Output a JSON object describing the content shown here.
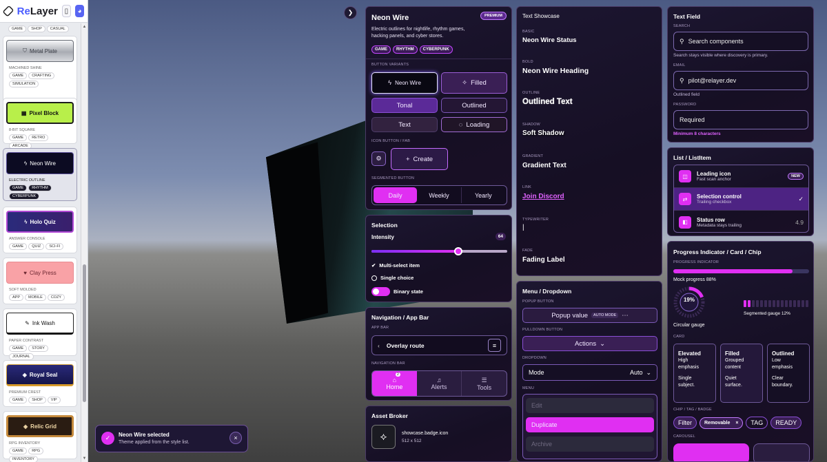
{
  "app": {
    "name_prefix": "Re",
    "name_suffix": "Layer"
  },
  "sidebar": {
    "top_tags": [
      "GAME",
      "SHOP",
      "CASUAL"
    ],
    "styles": [
      {
        "label": "Metal Plate",
        "sub": "MACHINED SHINE",
        "tags": [
          "GAME",
          "CRAFTING",
          "SIMULATION"
        ],
        "icon": "shield-icon"
      },
      {
        "label": "Pixel Block",
        "sub": "8-BIT SQUARE",
        "tags": [
          "GAME",
          "RETRO",
          "ARCADE"
        ],
        "icon": "grid-icon"
      },
      {
        "label": "Neon Wire",
        "sub": "ELECTRIC OUTLINE",
        "tags": [
          "GAME",
          "RHYTHM",
          "CYBERPUNK"
        ],
        "icon": "bolt-icon"
      },
      {
        "label": "Holo Quiz",
        "sub": "ANSWER CONSOLE",
        "tags": [
          "GAME",
          "QUIZ",
          "SCI-FI"
        ],
        "icon": "bolt-icon"
      },
      {
        "label": "Clay Press",
        "sub": "SOFT MOLDED",
        "tags": [
          "APP",
          "MOBILE",
          "COZY"
        ],
        "icon": "heart-icon"
      },
      {
        "label": "Ink Wash",
        "sub": "PAPER CONTRAST",
        "tags": [
          "GAME",
          "STORY",
          "JOURNAL"
        ],
        "icon": "brush-icon"
      },
      {
        "label": "Royal Seal",
        "sub": "PREMIUM CREST",
        "tags": [
          "GAME",
          "SHOP",
          "VIP"
        ],
        "icon": "gem-icon"
      },
      {
        "label": "Relic Grid",
        "sub": "RPG INVENTORY",
        "tags": [
          "GAME",
          "RPG",
          "INVENTORY"
        ],
        "icon": "gem-icon"
      }
    ]
  },
  "hero": {
    "title": "Neon Wire",
    "badge": "PREMIUM",
    "desc1": "Electric outlines for nightlife, rhythm games,",
    "desc2": "hacking panels, and cyber stores.",
    "tags": [
      "GAME",
      "RHYTHM",
      "CYBERPUNK"
    ],
    "button_variants_label": "BUTTON VARIANTS",
    "neon_wire": "Neon Wire",
    "filled": "Filled",
    "tonal": "Tonal",
    "outlined": "Outlined",
    "text": "Text",
    "loading": "Loading",
    "icon_fab_label": "ICON BUTTON / FAB",
    "create": "Create",
    "segmented_label": "SEGMENTED BUTTON",
    "segments": [
      "Daily",
      "Weekly",
      "Yearly"
    ]
  },
  "selection": {
    "title": "Selection",
    "intensity_label": "Intensity",
    "intensity": "64",
    "multi": "Multi-select item",
    "single": "Single choice",
    "binary": "Binary state"
  },
  "nav": {
    "title": "Navigation / App Bar",
    "app_bar_label": "APP BAR",
    "route": "Overlay route",
    "nav_bar_label": "NAVIGATION BAR",
    "items": [
      "Home",
      "Alerts",
      "Tools"
    ],
    "home_badge": "2"
  },
  "asset": {
    "title": "Asset Broker",
    "name": "showcase.badge.icon",
    "size": "512 x 512"
  },
  "text_showcase": {
    "title": "Text Showcase",
    "rows": [
      {
        "label": "BASIC",
        "text": "Neon Wire Status"
      },
      {
        "label": "BOLD",
        "text": "Neon Wire Heading"
      },
      {
        "label": "OUTLINE",
        "text": "Outlined Text"
      },
      {
        "label": "SHADOW",
        "text": "Soft Shadow"
      },
      {
        "label": "GRADIENT",
        "text": "Gradient Text"
      },
      {
        "label": "LINK",
        "text": "Join Discord"
      },
      {
        "label": "TYPEWRITER",
        "text": "|"
      },
      {
        "label": "FADE",
        "text": "Fading Label"
      }
    ]
  },
  "menu": {
    "title": "Menu / Dropdown",
    "popup_label": "POPUP BUTTON",
    "popup_value": "Popup value",
    "auto_mode": "AUTO MODE",
    "pulldown_label": "PULLDOWN BUTTON",
    "actions": "Actions",
    "dropdown_label": "DROPDOWN",
    "mode": "Mode",
    "mode_value": "Auto",
    "menu_label": "MENU",
    "items": [
      "Edit",
      "Duplicate",
      "Archive"
    ]
  },
  "text_field": {
    "title": "Text Field",
    "search_label": "SEARCH",
    "search_placeholder": "Search components",
    "search_hint": "Search stays visible where discovery is primary.",
    "email_label": "EMAIL",
    "email_value": "pilot@relayer.dev",
    "email_hint": "Outlined field",
    "password_label": "PASSWORD",
    "password_value": "Required",
    "password_hint": "Minimum 8 characters"
  },
  "list": {
    "title": "List / ListItem",
    "items": [
      {
        "title": "Leading icon",
        "sub": "Fast scan anchor",
        "trail": "NEW"
      },
      {
        "title": "Selection control",
        "sub": "Trailing checkbox",
        "trail": "✓"
      },
      {
        "title": "Status row",
        "sub": "Metadata stays trailing",
        "trail": "4.9"
      }
    ]
  },
  "progress": {
    "title": "Progress Indicator / Card / Chip",
    "progress_label": "PROGRESS INDICATOR",
    "mock_label": "Mock progress 88%",
    "mock_value": 0.88,
    "circular_value": "19%",
    "circular_fraction": 0.19,
    "circular_label": "Circular gauge",
    "segmented_label": "Segmented gauge 12%",
    "segmented_fraction": 0.12,
    "card_label": "CARD",
    "cards": [
      {
        "title": "Elevated",
        "l1": "High",
        "l2": "emphasis",
        "l3": "Single",
        "l4": "subject."
      },
      {
        "title": "Filled",
        "l1": "Grouped",
        "l2": "content",
        "l3": "Quiet",
        "l4": "surface."
      },
      {
        "title": "Outlined",
        "l1": "Low",
        "l2": "emphasis",
        "l3": "Clear",
        "l4": "boundary."
      }
    ],
    "chip_label": "CHIP / TAG / BADGE",
    "chips": [
      "Filter",
      "Removable",
      "TAG",
      "READY"
    ],
    "carousel_label": "CAROUSEL"
  },
  "toast": {
    "title": "Neon Wire selected",
    "sub": "Theme applied from the style list."
  },
  "colors": {
    "accent": "#e02ff2",
    "panel_bg": "#1a1228",
    "border": "#4b3a66"
  }
}
